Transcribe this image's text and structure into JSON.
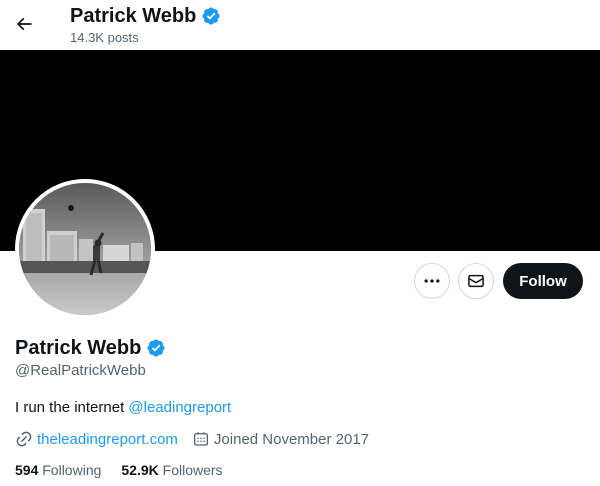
{
  "header": {
    "name": "Patrick Webb",
    "posts": "14.3K posts"
  },
  "profile": {
    "name": "Patrick Webb",
    "handle": "@RealPatrickWebb",
    "verified": true,
    "bio_text": "I run the internet ",
    "bio_mention": "@leadingreport",
    "website": "theleadingreport.com",
    "joined": "Joined November 2017"
  },
  "actions": {
    "follow_label": "Follow",
    "more_icon": "more-horizontal-icon",
    "message_icon": "envelope-icon"
  },
  "stats": {
    "following_count": "594",
    "following_label": "Following",
    "followers_count": "52.9K",
    "followers_label": "Followers"
  },
  "colors": {
    "accent": "#1d9bf0",
    "text": "#0f1419",
    "secondary": "#536471",
    "banner": "#000000"
  }
}
